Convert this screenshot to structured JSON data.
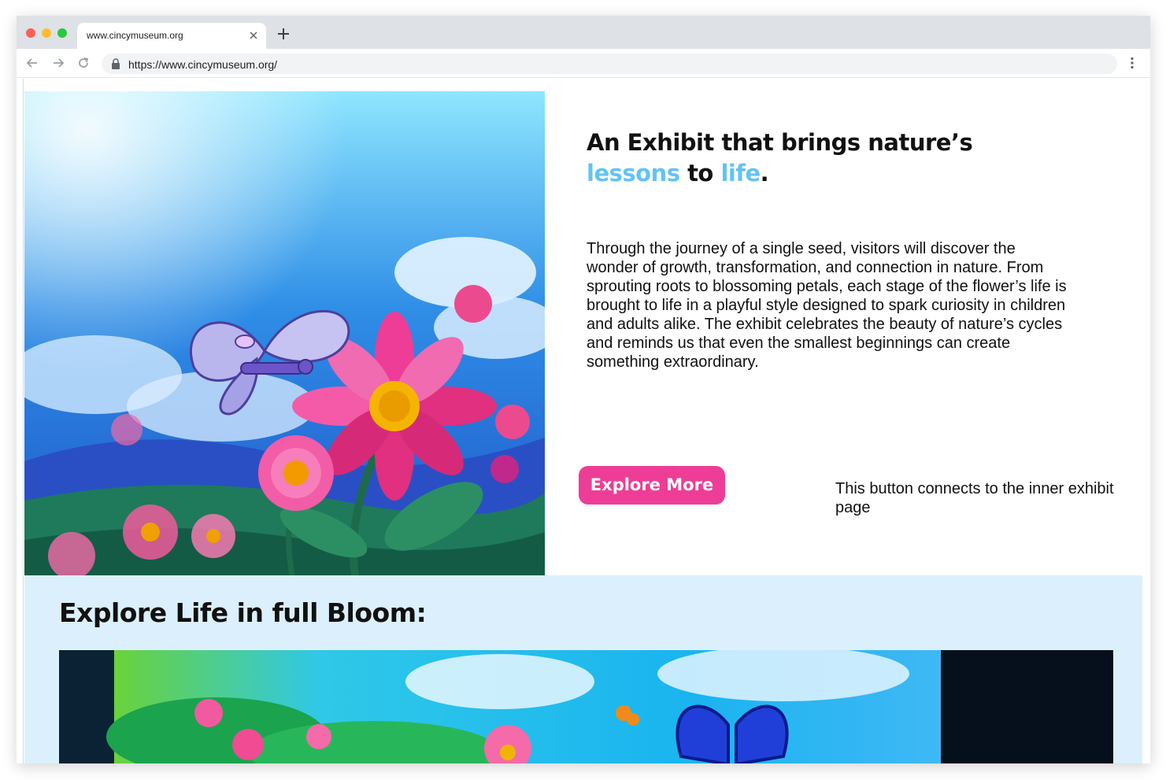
{
  "browser": {
    "tab_title": "www.cincymuseum.org",
    "url": "https://www.cincymuseum.org/"
  },
  "hero": {
    "headline_line1": "An Exhibit that brings nature’s",
    "headline_word_lessons": "lessons",
    "headline_word_to": " to ",
    "headline_word_life": "life",
    "headline_period": ".",
    "body": "Through the journey of a single seed, visitors will discover the wonder of growth, transformation, and connection in nature. From sprouting roots to blossoming petals, each stage of the flower’s life is brought to life in a playful style designed to spark curiosity in children and adults alike. The exhibit celebrates the beauty of nature’s cycles and reminds us that even the smallest beginnings can create something extraordinary.",
    "cta_label": "Explore More",
    "cta_note": "This button connects to the inner exhibit page"
  },
  "bloom": {
    "title": "Explore Life in full Bloom:"
  },
  "colors": {
    "accent": "#62c3f4",
    "cta": "#ee3d96",
    "section_bg": "#dbf0fc"
  },
  "icons": [
    "close-icon",
    "plus-icon",
    "back-arrow-icon",
    "forward-arrow-icon",
    "reload-icon",
    "lock-icon",
    "kebab-menu-icon"
  ]
}
